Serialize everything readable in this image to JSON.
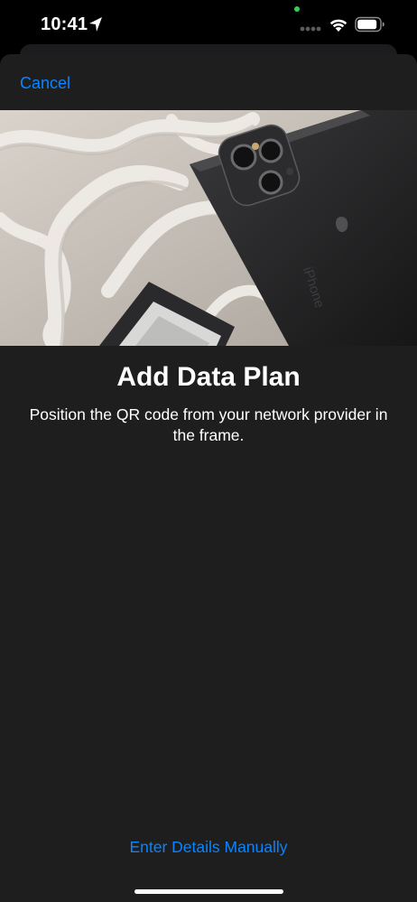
{
  "status_bar": {
    "time": "10:41",
    "icons": [
      "location-arrow-icon",
      "signal-icon",
      "wifi-icon",
      "battery-icon"
    ],
    "privacy_indicator_color": "#2fd158"
  },
  "sheet": {
    "cancel_label": "Cancel",
    "title": "Add Data Plan",
    "subtitle": "Position the QR code from your network provider in the frame.",
    "manual_entry_label": "Enter Details Manually"
  },
  "colors": {
    "accent": "#0a84ff",
    "sheet_background": "#1e1e1f",
    "background": "#000000"
  }
}
